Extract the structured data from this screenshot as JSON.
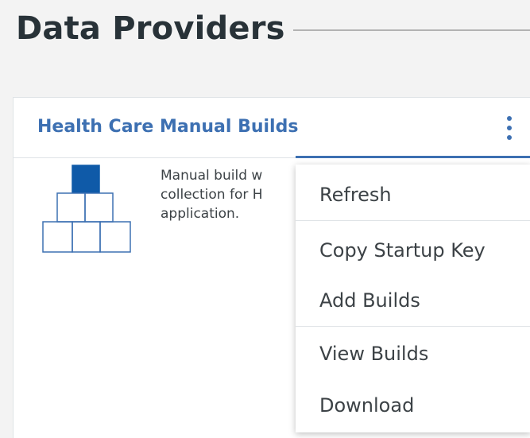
{
  "section": {
    "title": "Data Providers"
  },
  "card": {
    "title": "Health Care Manual Builds",
    "description_lines": [
      "Manual build w",
      "collection for H",
      "application."
    ],
    "icon": "pyramid-blocks-icon",
    "overflow_icon": "overflow-menu-vertical-icon"
  },
  "menu": {
    "items": [
      {
        "label": "Refresh"
      },
      {
        "label": "Copy Startup Key"
      },
      {
        "label": "Add Builds"
      },
      {
        "label": "View Builds"
      },
      {
        "label": "Download"
      }
    ]
  },
  "colors": {
    "accent": "#3d70b2",
    "icon_fill": "#3d70b2",
    "background": "#f3f3f3"
  }
}
